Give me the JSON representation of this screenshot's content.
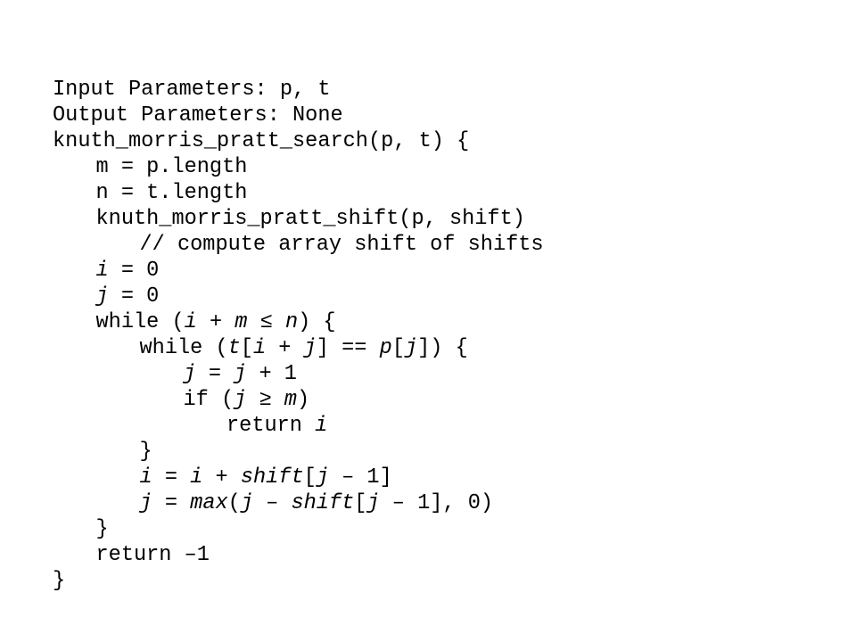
{
  "slide": {
    "lines": [
      {
        "indent": 0,
        "tokens": [
          {
            "t": "Input Parameters: p, t"
          }
        ]
      },
      {
        "indent": 0,
        "tokens": [
          {
            "t": "Output Parameters: None"
          }
        ]
      },
      {
        "indent": 0,
        "tokens": [
          {
            "t": "knuth_morris_pratt_search(p, t) {"
          }
        ]
      },
      {
        "indent": 1,
        "tokens": [
          {
            "t": "m = p.length"
          }
        ]
      },
      {
        "indent": 1,
        "tokens": [
          {
            "t": "n = t.length"
          }
        ]
      },
      {
        "indent": 1,
        "tokens": [
          {
            "t": "knuth_morris_pratt_shift(p, shift)"
          }
        ]
      },
      {
        "indent": 2,
        "tokens": [
          {
            "t": "// compute array shift of shifts"
          }
        ]
      },
      {
        "indent": 1,
        "tokens": [
          {
            "t": "i",
            "v": true
          },
          {
            "t": " = 0"
          }
        ]
      },
      {
        "indent": 1,
        "tokens": [
          {
            "t": "j",
            "v": true
          },
          {
            "t": " = 0"
          }
        ]
      },
      {
        "indent": 1,
        "tokens": [
          {
            "t": "while ("
          },
          {
            "t": "i",
            "v": true
          },
          {
            "t": " + "
          },
          {
            "t": "m",
            "v": true
          },
          {
            "t": " ≤ "
          },
          {
            "t": "n",
            "v": true
          },
          {
            "t": ") {"
          }
        ]
      },
      {
        "indent": 2,
        "tokens": [
          {
            "t": "while ("
          },
          {
            "t": "t",
            "v": true
          },
          {
            "t": "["
          },
          {
            "t": "i",
            "v": true
          },
          {
            "t": " + "
          },
          {
            "t": "j",
            "v": true
          },
          {
            "t": "] == "
          },
          {
            "t": "p",
            "v": true
          },
          {
            "t": "["
          },
          {
            "t": "j",
            "v": true
          },
          {
            "t": "]) {"
          }
        ]
      },
      {
        "indent": 3,
        "tokens": [
          {
            "t": "j",
            "v": true
          },
          {
            "t": " = "
          },
          {
            "t": "j",
            "v": true
          },
          {
            "t": " + 1"
          }
        ]
      },
      {
        "indent": 3,
        "tokens": [
          {
            "t": "if ("
          },
          {
            "t": "j",
            "v": true
          },
          {
            "t": " ≥ "
          },
          {
            "t": "m",
            "v": true
          },
          {
            "t": ")"
          }
        ]
      },
      {
        "indent": 4,
        "tokens": [
          {
            "t": "return "
          },
          {
            "t": "i",
            "v": true
          }
        ]
      },
      {
        "indent": 2,
        "tokens": [
          {
            "t": "}"
          }
        ]
      },
      {
        "indent": 2,
        "tokens": [
          {
            "t": "i",
            "v": true
          },
          {
            "t": " = "
          },
          {
            "t": "i",
            "v": true
          },
          {
            "t": " + "
          },
          {
            "t": "shift",
            "v": true
          },
          {
            "t": "["
          },
          {
            "t": "j",
            "v": true
          },
          {
            "t": " – 1]"
          }
        ]
      },
      {
        "indent": 2,
        "tokens": [
          {
            "t": "j",
            "v": true
          },
          {
            "t": " = "
          },
          {
            "t": "max",
            "v": true
          },
          {
            "t": "("
          },
          {
            "t": "j",
            "v": true
          },
          {
            "t": " – "
          },
          {
            "t": "shift",
            "v": true
          },
          {
            "t": "["
          },
          {
            "t": "j",
            "v": true
          },
          {
            "t": " – 1], 0)"
          }
        ]
      },
      {
        "indent": 1,
        "tokens": [
          {
            "t": "}"
          }
        ]
      },
      {
        "indent": 1,
        "tokens": [
          {
            "t": "return –1"
          }
        ]
      },
      {
        "indent": 0,
        "tokens": [
          {
            "t": "}"
          }
        ]
      }
    ]
  }
}
